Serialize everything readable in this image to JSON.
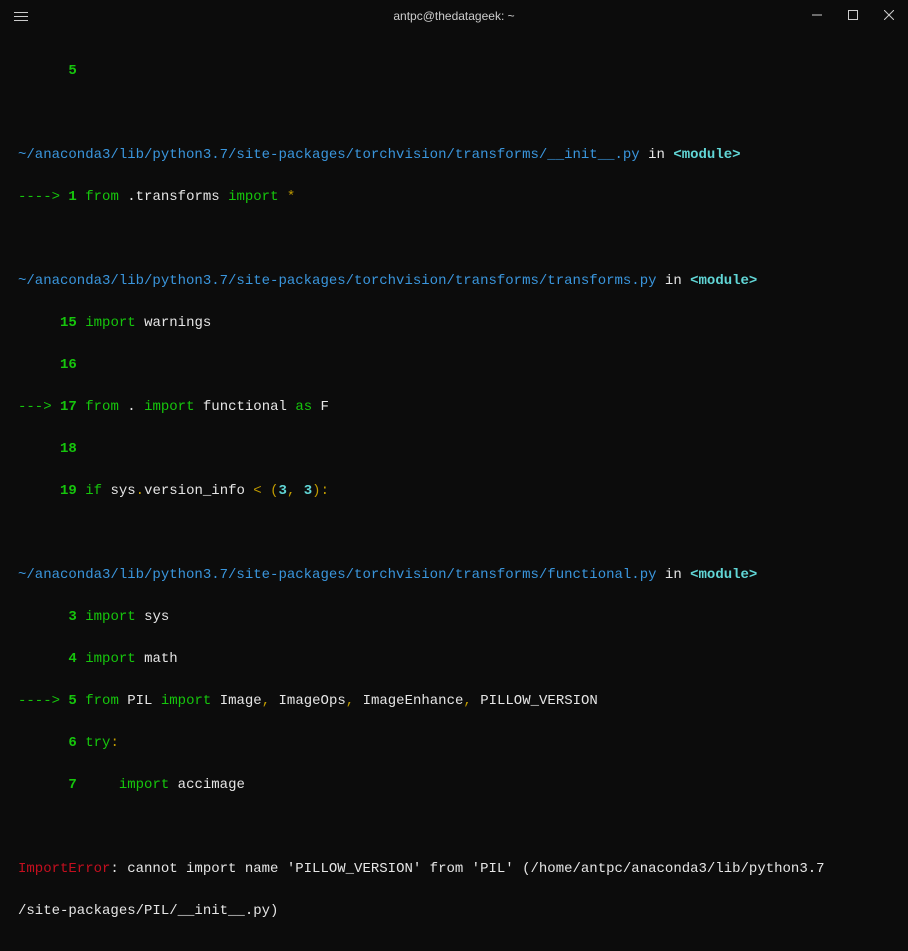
{
  "titlebar": {
    "title": "antpc@thedatageek: ~"
  },
  "line_five": "      5",
  "frame1": {
    "path": "~/anaconda3/lib/python3.7/site-packages/torchvision/transforms/__init__.py",
    "in": " in ",
    "module": "<module>",
    "arrow": "----> ",
    "num1": "1",
    "sp1": " ",
    "kw_from": "from",
    "sp2": " .",
    "mod": "transforms",
    "sp3": " ",
    "kw_import": "import",
    "sp4": " ",
    "star": "*"
  },
  "frame2": {
    "path": "~/anaconda3/lib/python3.7/site-packages/torchvision/transforms/transforms.py",
    "in": " in ",
    "module": "<module>",
    "pad5": "     ",
    "n15": "15",
    "sp": " ",
    "kw_import": "import",
    "sp2": " ",
    "warnings": "warnings",
    "n16": "16",
    "arrow": "---> ",
    "n17": "17",
    "kw_from": "from",
    "dot": " .",
    "sp3": " ",
    "functional": "functional",
    "kw_as": "as",
    "f": "F",
    "n18": "18",
    "n19": "19",
    "kw_if": "if",
    "sys": "sys",
    "dot2": ".",
    "verinfo": "version_info",
    "lt": " < ",
    "lp": "(",
    "three": "3",
    "comma": ",",
    "three2": "3",
    "rp": ")",
    "colon": ":"
  },
  "frame3": {
    "path": "~/anaconda3/lib/python3.7/site-packages/torchvision/transforms/functional.py",
    "in": " in ",
    "module": "<module>",
    "pad6": "      ",
    "n3": "3",
    "sp": " ",
    "kw_import": "import",
    "sp2": " ",
    "sys": "sys",
    "n4": "4",
    "math": "math",
    "arrow": "----> ",
    "n5": "5",
    "kw_from": "from",
    "pil": "PIL",
    "image": "Image",
    "comma": ",",
    "imageops": "ImageOps",
    "imageenhance": "ImageEnhance",
    "pillowver": "PILLOW_VERSION",
    "n6": "6",
    "kw_try": "try",
    "colon": ":",
    "n7": "7",
    "pad8": "     ",
    "accimage": "accimage"
  },
  "error": {
    "name": "ImportError",
    "msg": ": cannot import name 'PILLOW_VERSION' from 'PIL' (/home/antpc/anaconda3/lib/python3.7",
    "msg2": "/site-packages/PIL/__init__.py)"
  }
}
